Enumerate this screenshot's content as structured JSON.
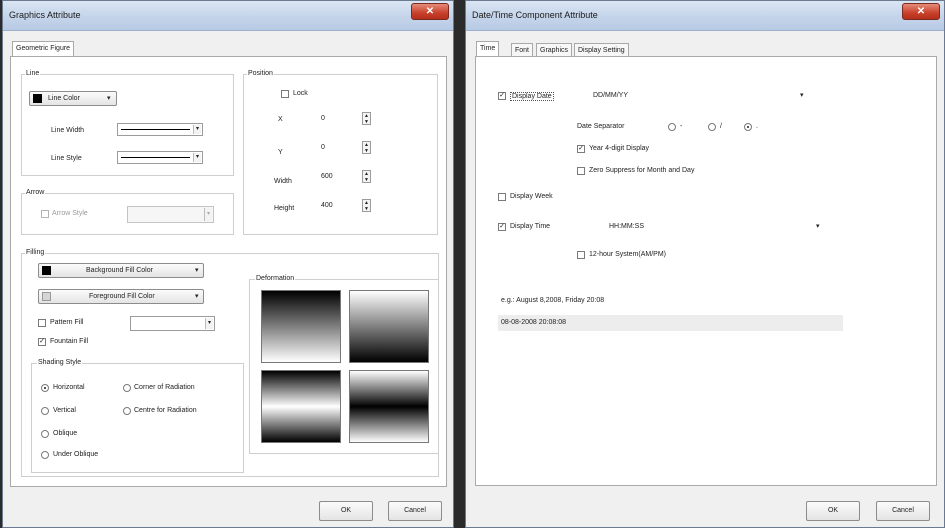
{
  "left_dialog": {
    "title": "Graphics Attribute",
    "close_icon": "close-icon",
    "tab": "Geometric Figure",
    "line": {
      "group": "Line",
      "color_button": "Line Color",
      "width_label": "Line Width",
      "style_label": "Line Style"
    },
    "arrow": {
      "group": "Arrow",
      "style_label": "Arrow Style"
    },
    "position": {
      "group": "Position",
      "lock": "Lock",
      "x_label": "X",
      "x_value": "0",
      "y_label": "Y",
      "y_value": "0",
      "width_label": "Width",
      "width_value": "600",
      "height_label": "Height",
      "height_value": "400"
    },
    "filling": {
      "group": "Filling",
      "bg_button": "Background Fill Color",
      "fg_button": "Foreground Fill Color",
      "pattern_fill": "Pattern Fill",
      "fountain_fill": "Fountain Fill"
    },
    "shading": {
      "group": "Shading Style",
      "horizontal": "Horizontal",
      "vertical": "Vertical",
      "oblique": "Oblique",
      "under_oblique": "Under Oblique",
      "corner": "Corner of Radiation",
      "centre": "Centre for Radiation"
    },
    "deformation": "Deformation",
    "ok": "OK",
    "cancel": "Cancel"
  },
  "right_dialog": {
    "title": "Date/Time Component Attribute",
    "close_icon": "close-icon",
    "tabs": [
      "Time",
      "Font",
      "Graphics",
      "Display Setting"
    ],
    "display_date": "Display Date",
    "date_format": "DD/MM/YY",
    "date_separator": "Date Separator",
    "sep_options": [
      "-",
      "/",
      "."
    ],
    "year_4digit": "Year 4-digit Display",
    "zero_suppress": "Zero Suppress for Month and Day",
    "display_week": "Display Week",
    "display_time": "Display Time",
    "time_format": "HH:MM:SS",
    "hour12": "12-hour System(AM/PM)",
    "example": "e.g.: August 8,2008, Friday 20:08",
    "preview": "08-08-2008 20:08:08",
    "ok": "OK",
    "cancel": "Cancel"
  }
}
